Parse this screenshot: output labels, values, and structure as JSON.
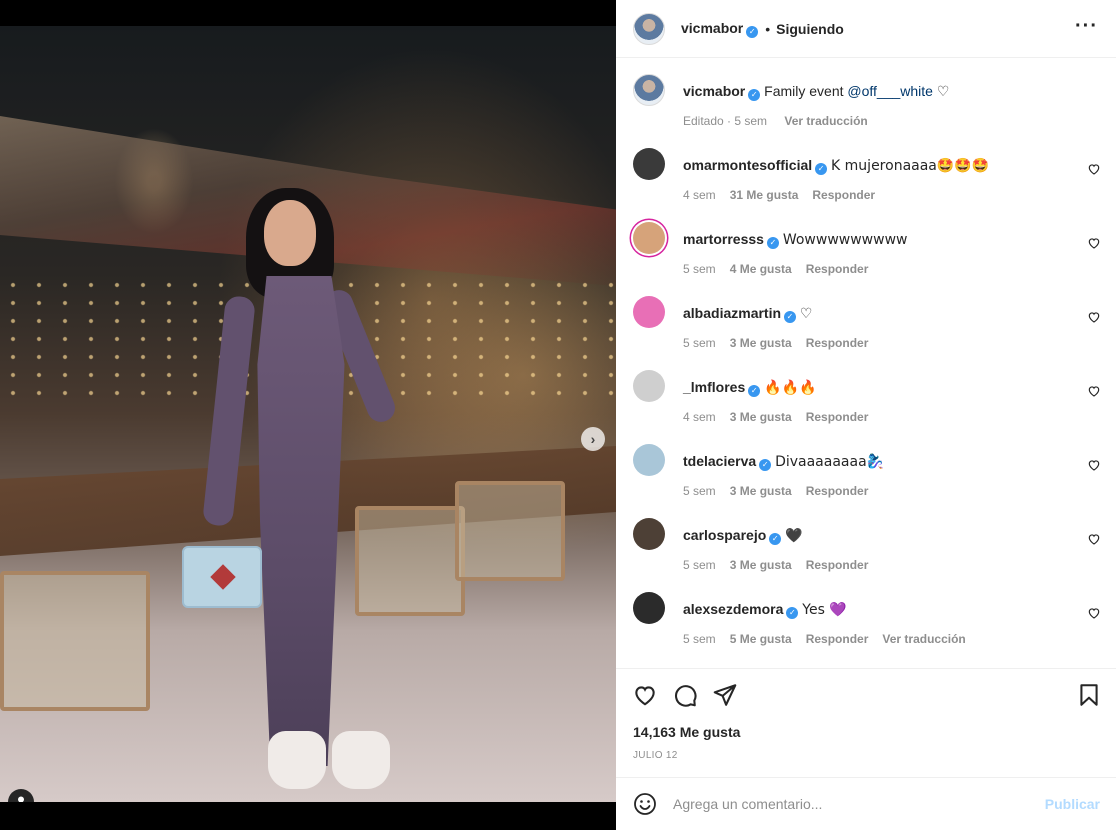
{
  "post": {
    "author": "vicmabor",
    "follow_separator": "•",
    "follow_label": "Siguiendo",
    "more_label": "···",
    "caption": {
      "user": "vicmabor",
      "text": "Family event ",
      "mention": "@off___white",
      "emoji": "♡",
      "time": "Editado · 5 sem",
      "translate": "Ver traducción"
    },
    "likes": "14,163 Me gusta",
    "date": "JULIO 12"
  },
  "comments": [
    {
      "user": "omarmontesofficial",
      "text": "K mujeronaaaa🤩🤩🤩",
      "time": "4 sem",
      "likes": "31 Me gusta",
      "reply": "Responder",
      "translate": "",
      "avatar_color": "#3a3a3a"
    },
    {
      "user": "martorresss",
      "text": "Wowwwwwwwww",
      "time": "5 sem",
      "likes": "4 Me gusta",
      "reply": "Responder",
      "translate": "",
      "avatar_color": "#d6a37a"
    },
    {
      "user": "albadiazmartin",
      "text": "♡",
      "time": "5 sem",
      "likes": "3 Me gusta",
      "reply": "Responder",
      "translate": "",
      "avatar_color": "#e86fb6"
    },
    {
      "user": "_lmflores",
      "text": "🔥🔥🔥",
      "time": "4 sem",
      "likes": "3 Me gusta",
      "reply": "Responder",
      "translate": "",
      "avatar_color": "#cfcfcf"
    },
    {
      "user": "tdelacierva",
      "text": "Divaaaaaaaa🧞‍♀️",
      "time": "5 sem",
      "likes": "3 Me gusta",
      "reply": "Responder",
      "translate": "",
      "avatar_color": "#a9c6d8"
    },
    {
      "user": "carlosparejo",
      "text": "🖤",
      "time": "5 sem",
      "likes": "3 Me gusta",
      "reply": "Responder",
      "translate": "",
      "avatar_color": "#4d4036"
    },
    {
      "user": "alexsezdemora",
      "text": "Yes 💜",
      "time": "5 sem",
      "likes": "5 Me gusta",
      "reply": "Responder",
      "translate": "Ver traducción",
      "avatar_color": "#2b2b2b"
    }
  ],
  "composer": {
    "placeholder": "Agrega un comentario...",
    "publish": "Publicar"
  },
  "media": {
    "next_arrow": "›",
    "slide_index": 1,
    "slide_count": 3
  },
  "icons": [
    "verified-icon",
    "more-icon",
    "heart-icon",
    "comment-icon",
    "share-icon",
    "bookmark-icon",
    "emoji-icon",
    "user-tag-icon",
    "next-arrow-icon"
  ],
  "colors": {
    "verified": "#3897f0",
    "link": "#00376b",
    "publish_disabled": "#b3dbff",
    "meta": "#8e8e8e"
  }
}
